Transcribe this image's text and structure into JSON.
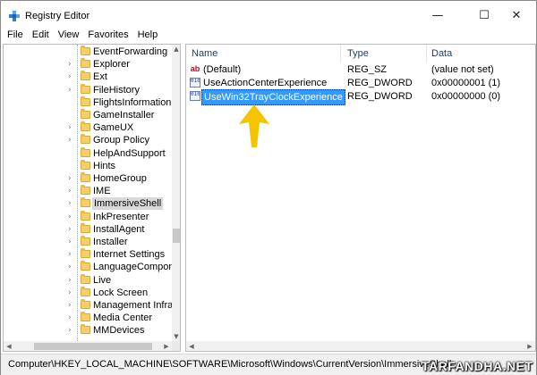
{
  "window": {
    "title": "Registry Editor",
    "controls": {
      "minimize": "—",
      "maximize": "☐",
      "close": "✕"
    }
  },
  "menu": [
    "File",
    "Edit",
    "View",
    "Favorites",
    "Help"
  ],
  "tree": {
    "items": [
      {
        "label": "EventForwarding",
        "expandable": false
      },
      {
        "label": "Explorer",
        "expandable": true
      },
      {
        "label": "Ext",
        "expandable": true
      },
      {
        "label": "FileHistory",
        "expandable": true
      },
      {
        "label": "FlightsInformation",
        "expandable": false
      },
      {
        "label": "GameInstaller",
        "expandable": false
      },
      {
        "label": "GameUX",
        "expandable": true
      },
      {
        "label": "Group Policy",
        "expandable": true
      },
      {
        "label": "HelpAndSupport",
        "expandable": false
      },
      {
        "label": "Hints",
        "expandable": false
      },
      {
        "label": "HomeGroup",
        "expandable": true
      },
      {
        "label": "IME",
        "expandable": true
      },
      {
        "label": "ImmersiveShell",
        "expandable": true,
        "selected": true
      },
      {
        "label": "InkPresenter",
        "expandable": true
      },
      {
        "label": "InstallAgent",
        "expandable": true
      },
      {
        "label": "Installer",
        "expandable": true
      },
      {
        "label": "Internet Settings",
        "expandable": true
      },
      {
        "label": "LanguageComponentsInstaller",
        "expandable": true
      },
      {
        "label": "Live",
        "expandable": true
      },
      {
        "label": "Lock Screen",
        "expandable": true
      },
      {
        "label": "Management Infrastructure",
        "expandable": true
      },
      {
        "label": "Media Center",
        "expandable": true
      },
      {
        "label": "MMDevices",
        "expandable": true
      }
    ]
  },
  "list": {
    "columns": {
      "name": "Name",
      "type": "Type",
      "data": "Data"
    },
    "rows": [
      {
        "icon": "string-value-icon",
        "icon_text": "ab",
        "name": "(Default)",
        "type": "REG_SZ",
        "data": "(value not set)"
      },
      {
        "icon": "dword-value-icon",
        "icon_text": "010",
        "name": "UseActionCenterExperience",
        "type": "REG_DWORD",
        "data": "0x00000001 (1)"
      },
      {
        "icon": "dword-value-icon",
        "icon_text": "010",
        "name": "UseWin32TrayClockExperience",
        "type": "REG_DWORD",
        "data": "0x00000000 (0)",
        "selected": true
      }
    ]
  },
  "status": {
    "path": "Computer\\HKEY_LOCAL_MACHINE\\SOFTWARE\\Microsoft\\Windows\\CurrentVersion\\ImmersiveShell"
  },
  "watermark": "TARFANDHA.NET",
  "colors": {
    "selection": "#3399ff",
    "tree_selection": "#d9d9d9",
    "annotation_arrow": "#f5c400",
    "folder": "#f4cf6a"
  }
}
